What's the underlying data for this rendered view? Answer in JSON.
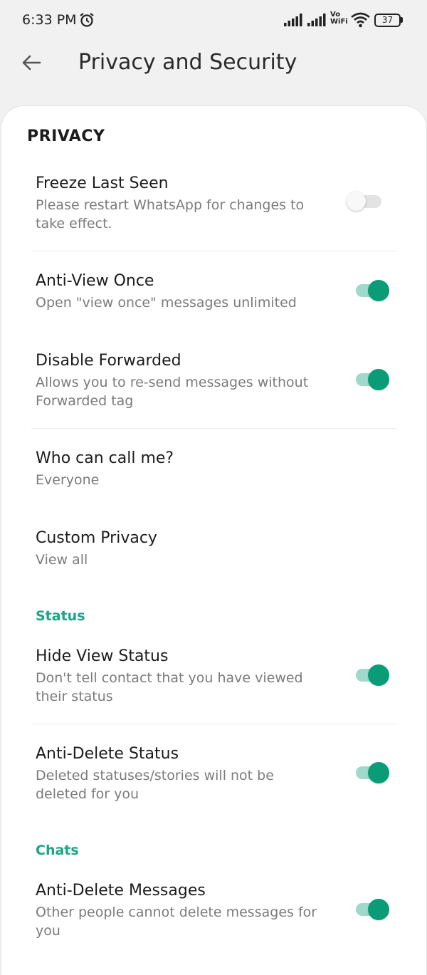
{
  "status_bar": {
    "time": "6:33 PM",
    "volte_line1": "Vo",
    "volte_line2": "WiFi",
    "battery": "37"
  },
  "toolbar": {
    "title": "Privacy and Security"
  },
  "privacy": {
    "header": "PRIVACY",
    "freeze_last_seen": {
      "title": "Freeze Last Seen",
      "subtitle": "Please restart WhatsApp for changes to take effect.",
      "enabled": false
    },
    "anti_view_once": {
      "title": "Anti-View Once",
      "subtitle": "Open \"view once\" messages unlimited",
      "enabled": true
    },
    "disable_forwarded": {
      "title": "Disable Forwarded",
      "subtitle": "Allows you to re-send messages without Forwarded tag",
      "enabled": true
    },
    "who_can_call": {
      "title": "Who can call me?",
      "subtitle": "Everyone"
    },
    "custom_privacy": {
      "title": "Custom Privacy",
      "subtitle": "View all"
    }
  },
  "status": {
    "header": "Status",
    "hide_view_status": {
      "title": "Hide View Status",
      "subtitle": "Don't tell contact that you have viewed their status",
      "enabled": true
    },
    "anti_delete_status": {
      "title": "Anti-Delete Status",
      "subtitle": "Deleted statuses/stories will not be deleted for you",
      "enabled": true
    }
  },
  "chats": {
    "header": "Chats",
    "anti_delete_messages": {
      "title": "Anti-Delete Messages",
      "subtitle": "Other people cannot delete messages for you",
      "enabled": true
    }
  },
  "colors": {
    "accent": "#0a9c77",
    "accent_track": "#9fd9c9",
    "section_header": "#1fa387",
    "background": "#f1f1f1"
  }
}
